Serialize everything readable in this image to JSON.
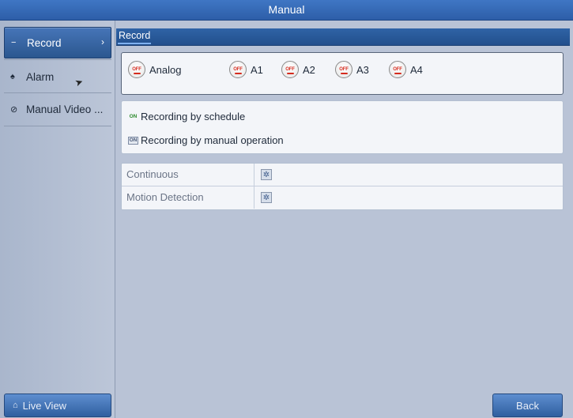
{
  "window": {
    "title": "Manual"
  },
  "sidebar": {
    "items": [
      {
        "label": "Record",
        "icon": "minus-icon",
        "active": true
      },
      {
        "label": "Alarm",
        "icon": "alarm-icon"
      },
      {
        "label": "Manual Video ...",
        "icon": "video-check-icon"
      }
    ],
    "live_view_label": "Live View"
  },
  "tabs": [
    {
      "label": "Record"
    }
  ],
  "cameras": [
    {
      "name": "Analog",
      "state": "OFF"
    },
    {
      "name": "A1",
      "state": "OFF"
    },
    {
      "name": "A2",
      "state": "OFF"
    },
    {
      "name": "A3",
      "state": "OFF"
    },
    {
      "name": "A4",
      "state": "OFF"
    }
  ],
  "legend": [
    {
      "chip": "ON",
      "label": "Recording by schedule"
    },
    {
      "chip": "ON",
      "label": "Recording by manual operation"
    }
  ],
  "modes": [
    {
      "label": "Continuous"
    },
    {
      "label": "Motion Detection"
    }
  ],
  "footer": {
    "back_label": "Back"
  },
  "colors": {
    "titlebar": "#3566b0",
    "active_item": "#3a69a8",
    "off_red": "#d52b1e",
    "on_green": "#2c8a2c"
  }
}
